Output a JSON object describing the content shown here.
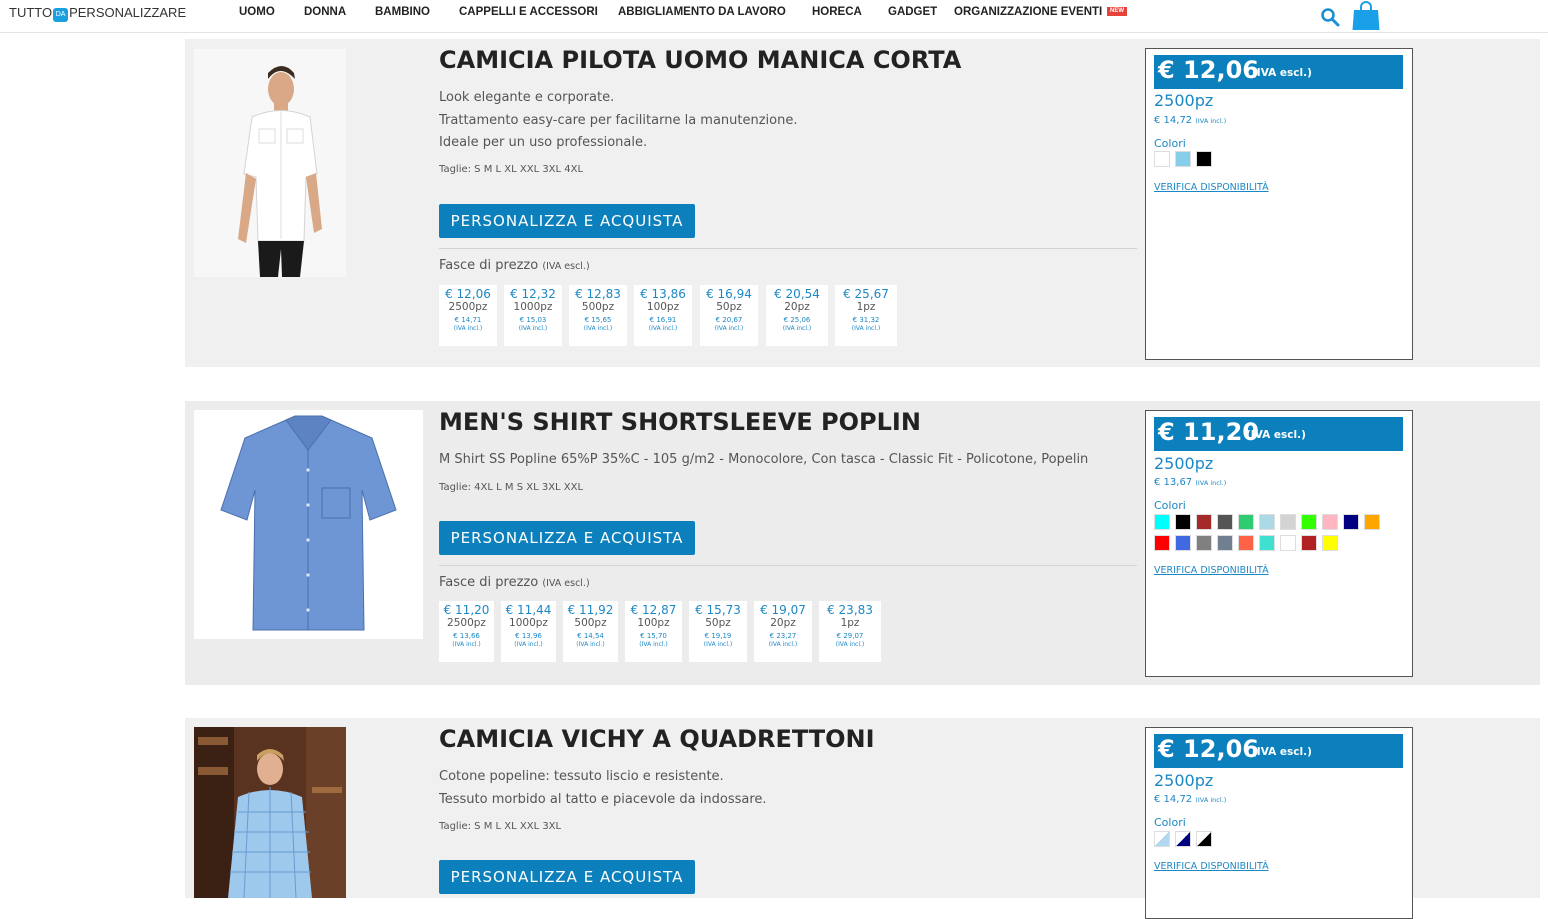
{
  "header": {
    "logo": {
      "left": "TUTTO",
      "mid": "DA",
      "right": "PERSONALIZZARE"
    },
    "nav": [
      "UOMO",
      "DONNA",
      "BAMBINO",
      "CAPPELLI E ACCESSORI",
      "ABBIGLIAMENTO DA LAVORO",
      "HORECA",
      "GADGET",
      "ORGANIZZAZIONE EVENTI"
    ],
    "new_badge": "NEW",
    "icons": [
      "search-icon",
      "shopping-bag-icon"
    ]
  },
  "products": [
    {
      "title": "CAMICIA PILOTA UOMO MANICA CORTA",
      "desc": [
        "Look elegante e corporate.",
        "Trattamento easy-care per facilitarne la manutenzione.",
        "Ideale per un uso professionale."
      ],
      "sizes": "Taglie: S M L XL XXL 3XL 4XL",
      "button": "PERSONALIZZA E ACQUISTA",
      "tiers_label": "Fasce di prezzo",
      "tiers_note": "(IVA escl.)",
      "tiers": [
        {
          "price": "€ 12,06",
          "qty": "2500pz",
          "vat": "€ 14,71",
          "inc": "(IVA incl.)"
        },
        {
          "price": "€ 12,32",
          "qty": "1000pz",
          "vat": "€ 15,03",
          "inc": "(IVA incl.)"
        },
        {
          "price": "€ 12,83",
          "qty": "500pz",
          "vat": "€ 15,65",
          "inc": "(IVA incl.)"
        },
        {
          "price": "€ 13,86",
          "qty": "100pz",
          "vat": "€ 16,91",
          "inc": "(IVA incl.)"
        },
        {
          "price": "€ 16,94",
          "qty": "50pz",
          "vat": "€ 20,67",
          "inc": "(IVA incl.)"
        },
        {
          "price": "€ 20,54",
          "qty": "20pz",
          "vat": "€ 25,06",
          "inc": "(IVA incl.)"
        },
        {
          "price": "€ 25,67",
          "qty": "1pz",
          "vat": "€ 31,32",
          "inc": "(IVA incl.)"
        }
      ],
      "box": {
        "price": "€ 12,06",
        "price_note": "(IVA escl.)",
        "qty": "2500pz",
        "vat": "€ 14,72",
        "vat_note": "(IVA incl.)",
        "colori": "Colori",
        "colors": [
          "#ffffff",
          "#87ceeb",
          "#000000"
        ],
        "link": "VERIFICA DISPONIBILITÀ"
      }
    },
    {
      "title": "MEN'S SHIRT SHORTSLEEVE POPLIN",
      "desc": [
        "M Shirt SS Popline 65%P 35%C - 105 g/m2 - Monocolore, Con tasca - Classic Fit - Policotone, Popelin"
      ],
      "sizes": "Taglie: 4XL L M S XL 3XL XXL",
      "button": "PERSONALIZZA E ACQUISTA",
      "tiers_label": "Fasce di prezzo",
      "tiers_note": "(IVA escl.)",
      "tiers": [
        {
          "price": "€ 11,20",
          "qty": "2500pz",
          "vat": "€ 13,66",
          "inc": "(IVA incl.)"
        },
        {
          "price": "€ 11,44",
          "qty": "1000pz",
          "vat": "€ 13,96",
          "inc": "(IVA incl.)"
        },
        {
          "price": "€ 11,92",
          "qty": "500pz",
          "vat": "€ 14,54",
          "inc": "(IVA incl.)"
        },
        {
          "price": "€ 12,87",
          "qty": "100pz",
          "vat": "€ 15,70",
          "inc": "(IVA incl.)"
        },
        {
          "price": "€ 15,73",
          "qty": "50pz",
          "vat": "€ 19,19",
          "inc": "(IVA incl.)"
        },
        {
          "price": "€ 19,07",
          "qty": "20pz",
          "vat": "€ 23,27",
          "inc": "(IVA incl.)"
        },
        {
          "price": "€ 23,83",
          "qty": "1pz",
          "vat": "€ 29,07",
          "inc": "(IVA incl.)"
        }
      ],
      "box": {
        "price": "€ 11,20",
        "price_note": "(IVA escl.)",
        "qty": "2500pz",
        "vat": "€ 13,67",
        "vat_note": "(IVA incl.)",
        "colori": "Colori",
        "colors": [
          "#00ffff",
          "#000000",
          "#a52a2a",
          "#555555",
          "#2ecc71",
          "#add8e6",
          "#d3d3d3",
          "#32ff00",
          "#ffb6c1",
          "#000080",
          "#ffa500",
          "#ff0000",
          "#4169e1",
          "#808080",
          "#708090",
          "#ff6347",
          "#40e0d0",
          "#ffffff",
          "#b22222",
          "#ffff00"
        ],
        "link": "VERIFICA DISPONIBILITÀ"
      }
    },
    {
      "title": "CAMICIA VICHY A QUADRETTONI",
      "desc": [
        "Cotone popeline: tessuto liscio e resistente.",
        "Tessuto morbido al tatto e piacevole da indossare."
      ],
      "sizes": "Taglie: S M L XL XXL 3XL",
      "button": "PERSONALIZZA E ACQUISTA",
      "box": {
        "price": "€ 12,06",
        "price_note": "(IVA escl.)",
        "qty": "2500pz",
        "vat": "€ 14,72",
        "vat_note": "(IVA incl.)",
        "colori": "Colori",
        "colors": [
          "#b0d8f0",
          "#000080",
          "#000000"
        ],
        "link": "VERIFICA DISPONIBILITÀ"
      }
    }
  ]
}
